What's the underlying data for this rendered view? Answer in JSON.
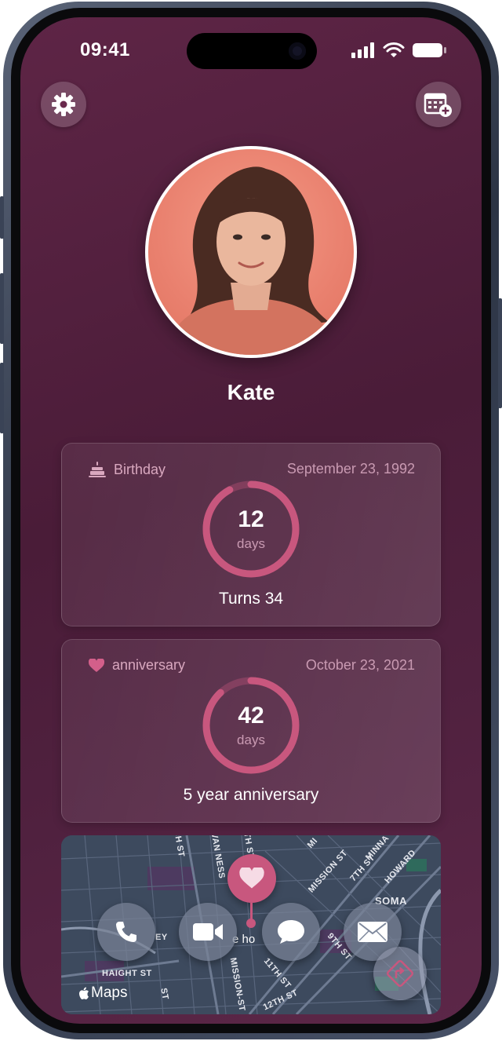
{
  "status_bar": {
    "time": "09:41"
  },
  "header": {
    "settings_icon": "gear-icon",
    "calendar_icon": "calendar-add-icon"
  },
  "profile": {
    "name": "Kate"
  },
  "events": [
    {
      "icon": "cake-icon",
      "label": "Birthday",
      "date": "September 23, 1992",
      "count": "12",
      "unit": "days",
      "caption": "Turns 34",
      "progress": 0.92
    },
    {
      "icon": "heart-icon",
      "label": "anniversary",
      "date": "October 23, 2021",
      "count": "42",
      "unit": "days",
      "caption": "5 year anniversary",
      "progress": 0.88
    }
  ],
  "map": {
    "brand": "Maps",
    "pin_label": "e ho",
    "streets": [
      "VAN NESS",
      "6TH ST",
      "GH ST",
      "MISSION ST",
      "7TH ST",
      "HOWARD",
      "SOMA",
      "9TH ST",
      "11TH ST",
      "12TH ST",
      "HAIGHT ST",
      "MISSION-ST",
      "ST",
      "EY",
      "MINNA",
      "MI"
    ],
    "actions": [
      {
        "name": "call",
        "icon": "phone-icon"
      },
      {
        "name": "video",
        "icon": "video-camera-icon"
      },
      {
        "name": "message",
        "icon": "message-bubble-icon"
      },
      {
        "name": "mail",
        "icon": "envelope-icon"
      }
    ],
    "directions_icon": "directions-icon"
  },
  "colors": {
    "accent": "#c8577e",
    "background": "#4a1c38"
  }
}
